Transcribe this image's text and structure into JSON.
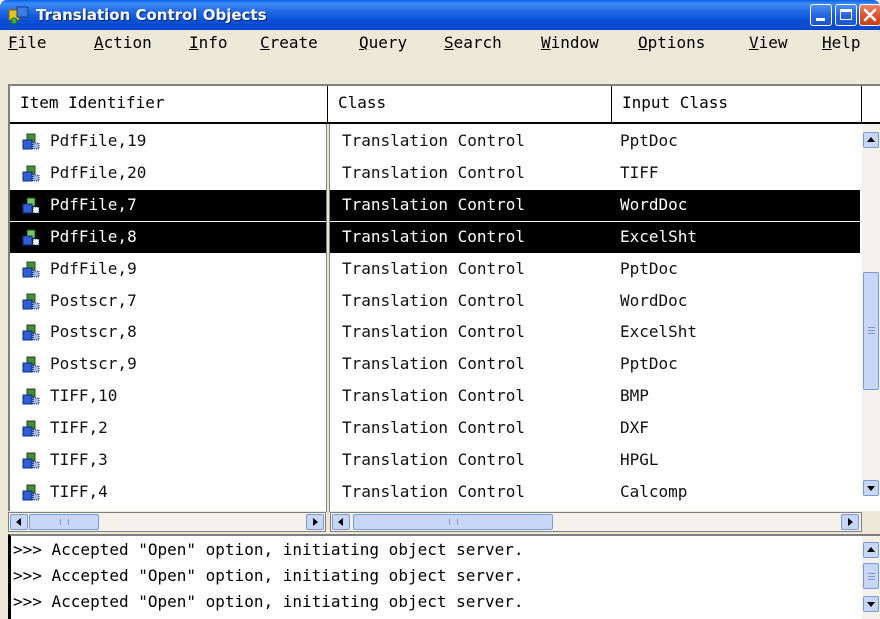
{
  "window": {
    "title": "Translation Control Objects",
    "accent": "#0A48C8",
    "selection_color": "#000000"
  },
  "menu": {
    "items": [
      {
        "label": "File",
        "mnemonic": "F"
      },
      {
        "label": "Action",
        "mnemonic": "A"
      },
      {
        "label": "Info",
        "mnemonic": "I"
      },
      {
        "label": "Create",
        "mnemonic": "C"
      },
      {
        "label": "Query",
        "mnemonic": "Q"
      },
      {
        "label": "Search",
        "mnemonic": "S"
      },
      {
        "label": "Window",
        "mnemonic": "W"
      },
      {
        "label": "Options",
        "mnemonic": "O"
      },
      {
        "label": "View",
        "mnemonic": "V"
      },
      {
        "label": "Help",
        "mnemonic": "H"
      }
    ]
  },
  "table": {
    "columns": [
      "Item Identifier",
      "Class",
      "Input Class"
    ],
    "rows": [
      {
        "id": "PdfFile,19",
        "class": "Translation Control",
        "input_class": "PptDoc",
        "selected": false
      },
      {
        "id": "PdfFile,20",
        "class": "Translation Control",
        "input_class": "TIFF",
        "selected": false
      },
      {
        "id": "PdfFile,7",
        "class": "Translation Control",
        "input_class": "WordDoc",
        "selected": true
      },
      {
        "id": "PdfFile,8",
        "class": "Translation Control",
        "input_class": "ExcelSht",
        "selected": true
      },
      {
        "id": "PdfFile,9",
        "class": "Translation Control",
        "input_class": "PptDoc",
        "selected": false
      },
      {
        "id": "Postscr,7",
        "class": "Translation Control",
        "input_class": "WordDoc",
        "selected": false
      },
      {
        "id": "Postscr,8",
        "class": "Translation Control",
        "input_class": "ExcelSht",
        "selected": false
      },
      {
        "id": "Postscr,9",
        "class": "Translation Control",
        "input_class": "PptDoc",
        "selected": false
      },
      {
        "id": "TIFF,10",
        "class": "Translation Control",
        "input_class": "BMP",
        "selected": false
      },
      {
        "id": "TIFF,2",
        "class": "Translation Control",
        "input_class": "DXF",
        "selected": false
      },
      {
        "id": "TIFF,3",
        "class": "Translation Control",
        "input_class": "HPGL",
        "selected": false
      },
      {
        "id": "TIFF,4",
        "class": "Translation Control",
        "input_class": "Calcomp",
        "selected": false
      }
    ]
  },
  "log": {
    "lines": [
      ">>> Accepted \"Open\" option, initiating object server.",
      ">>> Accepted \"Open\" option, initiating object server.",
      ">>> Accepted \"Open\" option, initiating object server."
    ]
  },
  "icons": {
    "app": "app-puzzle-icon",
    "row": "translation-object-icon",
    "minimize": "minimize-icon",
    "maximize": "maximize-icon",
    "close": "close-icon"
  }
}
